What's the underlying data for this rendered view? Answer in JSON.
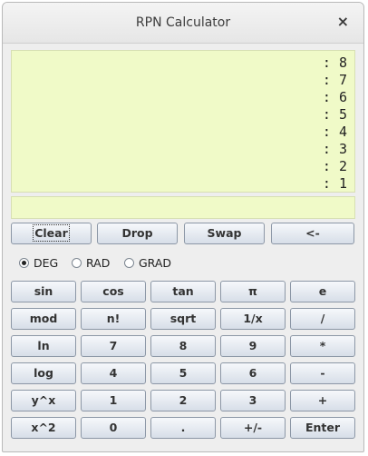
{
  "window": {
    "title": "RPN Calculator",
    "close_glyph": "×"
  },
  "stack": {
    "rows": [
      ": 8",
      ": 7",
      ": 6",
      ": 5",
      ": 4",
      ": 3",
      ": 2",
      ": 1"
    ]
  },
  "input": {
    "value": ""
  },
  "ops": {
    "clear": "Clear",
    "drop": "Drop",
    "swap": "Swap",
    "backspace": "<-"
  },
  "angle": {
    "deg": "DEG",
    "rad": "RAD",
    "grad": "GRAD",
    "selected": "DEG"
  },
  "keys": [
    [
      "sin",
      "cos",
      "tan",
      "π",
      "e"
    ],
    [
      "mod",
      "n!",
      "sqrt",
      "1/x",
      "/"
    ],
    [
      "ln",
      "7",
      "8",
      "9",
      "*"
    ],
    [
      "log",
      "4",
      "5",
      "6",
      "-"
    ],
    [
      "y^x",
      "1",
      "2",
      "3",
      "+"
    ],
    [
      "x^2",
      "0",
      ".",
      "+/-",
      "Enter"
    ]
  ],
  "colors": {
    "display_bg": "#f0fac8",
    "button_top": "#f6f8fb",
    "button_bottom": "#d7dee8"
  }
}
